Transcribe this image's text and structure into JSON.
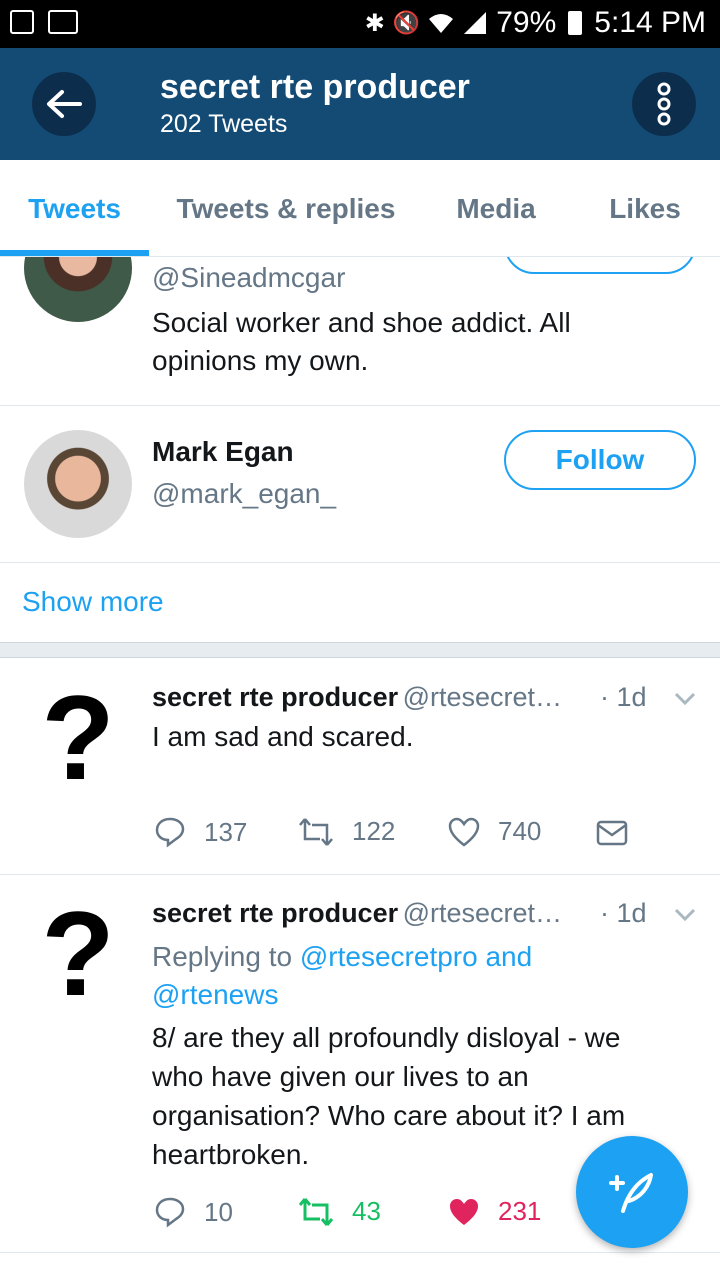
{
  "status_bar": {
    "battery": "79%",
    "time": "5:14 PM"
  },
  "header": {
    "title": "secret rte producer",
    "subtitle": "202 Tweets"
  },
  "tabs": [
    {
      "label": "Tweets",
      "active": true
    },
    {
      "label": "Tweets & replies",
      "active": false
    },
    {
      "label": "Media",
      "active": false
    },
    {
      "label": "Likes",
      "active": false
    }
  ],
  "suggestions": [
    {
      "handle": "@Sineadmcgar",
      "bio": "Social worker and shoe addict. All opinions my own."
    },
    {
      "name": "Mark Egan",
      "handle": "@mark_egan_",
      "follow_label": "Follow"
    }
  ],
  "show_more_label": "Show more",
  "tweets": [
    {
      "author": "secret rte producer",
      "handle": "@rtesecret…",
      "time": "· 1d",
      "text": "I am sad and scared.",
      "replies": "137",
      "retweets": "122",
      "likes": "740"
    },
    {
      "author": "secret rte producer",
      "handle": "@rtesecret…",
      "time": "· 1d",
      "reply_prefix": "Replying to ",
      "reply_target1": "@rtesecretpro",
      "reply_and": " and",
      "reply_target2": "@rtenews",
      "text": "8/ are they all profoundly disloyal - we who have given our lives to an organisation? Who care about it? I am heartbroken.",
      "replies": "10",
      "retweets": "43",
      "likes": "231"
    }
  ],
  "colors": {
    "header": "#134b75",
    "accent": "#1da1f2",
    "retweet": "#17bf63",
    "like": "#e0245e"
  }
}
